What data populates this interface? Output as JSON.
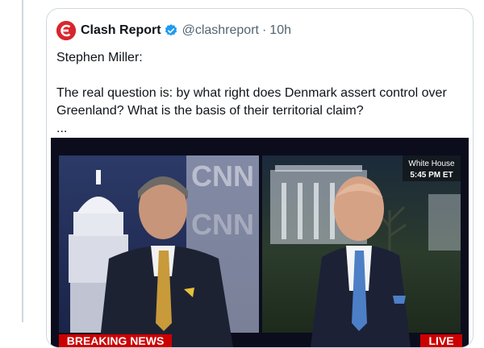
{
  "quoted_tweet": {
    "display_name": "Clash Report",
    "handle": "@clashreport",
    "separator": "·",
    "time": "10h",
    "text_lines": [
      "Stephen Miller:",
      "",
      "The real question is: by what right does Denmark assert control over",
      "Greenland? What is the basis of their territorial claim?",
      "..."
    ]
  },
  "video": {
    "watermark": "CNN",
    "location_label": "White House",
    "time_label": "5:45 PM ET",
    "breaking_label": "BREAKING NEWS",
    "live_label": "LIVE"
  },
  "colors": {
    "brand_red": "#d7262e",
    "verified_blue": "#1d9bf0",
    "secondary_text": "#536471",
    "border": "#cfd9de"
  },
  "icons": {
    "avatar": "clash-report-logo",
    "verified": "verified-badge-icon"
  }
}
